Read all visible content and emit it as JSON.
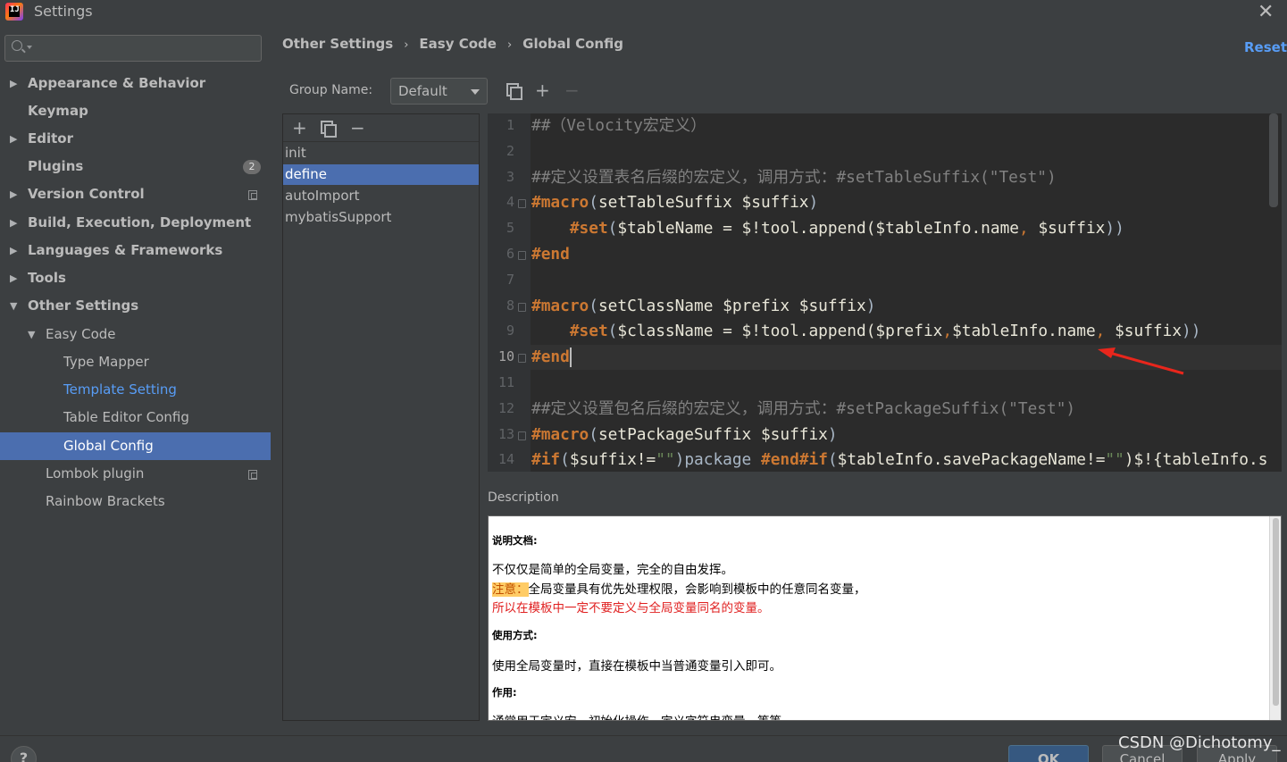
{
  "window": {
    "title": "Settings",
    "close_glyph": "✕"
  },
  "search": {
    "value": "",
    "placeholder": ""
  },
  "sidebar": {
    "items": [
      {
        "label": "Appearance & Behavior",
        "arrow": "▶"
      },
      {
        "label": "Keymap"
      },
      {
        "label": "Editor",
        "arrow": "▶"
      },
      {
        "label": "Plugins",
        "badge": "2"
      },
      {
        "label": "Version Control",
        "arrow": "▶"
      },
      {
        "label": "Build, Execution, Deployment",
        "arrow": "▶"
      },
      {
        "label": "Languages & Frameworks",
        "arrow": "▶"
      },
      {
        "label": "Tools",
        "arrow": "▶"
      },
      {
        "label": "Other Settings",
        "arrow": "▼"
      },
      {
        "label": "Easy Code",
        "arrow": "▼"
      },
      {
        "label": "Type Mapper"
      },
      {
        "label": "Template Setting"
      },
      {
        "label": "Table Editor Config"
      },
      {
        "label": "Global Config"
      },
      {
        "label": "Lombok plugin"
      },
      {
        "label": "Rainbow Brackets"
      }
    ]
  },
  "breadcrumb": {
    "items": [
      "Other Settings",
      "Easy Code",
      "Global Config"
    ],
    "separator": "›"
  },
  "reset_label": "Reset",
  "group": {
    "label": "Group Name:",
    "selected": "Default"
  },
  "toolbar": {
    "add_glyph": "+",
    "remove_glyph": "−"
  },
  "templates": {
    "items": [
      "init",
      "define",
      "autoImport",
      "mybatisSupport"
    ],
    "selected": "define"
  },
  "editor": {
    "line_numbers": [
      "1",
      "2",
      "3",
      "4",
      "5",
      "6",
      "7",
      "8",
      "9",
      "10",
      "11",
      "12",
      "13",
      "14"
    ],
    "lines": [
      [
        {
          "t": "##（Velocity宏定义）",
          "c": "cmt"
        }
      ],
      [],
      [
        {
          "t": "##定义设置表名后缀的宏定义，调用方式：#setTableSuffix(\"Test\")",
          "c": "cmt"
        }
      ],
      [
        {
          "t": "#macro",
          "c": "dir"
        },
        {
          "t": "(",
          "c": "plain"
        },
        {
          "t": "setTableSuffix ",
          "c": "var"
        },
        {
          "t": "$suffix",
          "c": "var"
        },
        {
          "t": ")",
          "c": "plain"
        }
      ],
      [
        {
          "t": "    ",
          "c": "plain"
        },
        {
          "t": "#set",
          "c": "dir"
        },
        {
          "t": "(",
          "c": "plain"
        },
        {
          "t": "$tableName = $!tool.append(",
          "c": "var"
        },
        {
          "t": "$tableInfo.name",
          "c": "var"
        },
        {
          "t": ", ",
          "c": "op"
        },
        {
          "t": "$suffix",
          "c": "var"
        },
        {
          "t": "))",
          "c": "plain"
        }
      ],
      [
        {
          "t": "#end",
          "c": "dir"
        }
      ],
      [],
      [
        {
          "t": "#macro",
          "c": "dir"
        },
        {
          "t": "(",
          "c": "plain"
        },
        {
          "t": "setClassName ",
          "c": "var"
        },
        {
          "t": "$prefix $suffix",
          "c": "var"
        },
        {
          "t": ")",
          "c": "plain"
        }
      ],
      [
        {
          "t": "    ",
          "c": "plain"
        },
        {
          "t": "#set",
          "c": "dir"
        },
        {
          "t": "(",
          "c": "plain"
        },
        {
          "t": "$className = $!tool.append(",
          "c": "var"
        },
        {
          "t": "$prefix",
          "c": "var"
        },
        {
          "t": ",",
          "c": "op"
        },
        {
          "t": "$tableInfo.name",
          "c": "var"
        },
        {
          "t": ", ",
          "c": "op"
        },
        {
          "t": "$suffix",
          "c": "var"
        },
        {
          "t": "))",
          "c": "plain"
        }
      ],
      [
        {
          "t": "#end",
          "c": "dir"
        }
      ],
      [],
      [
        {
          "t": "##定义设置包名后缀的宏定义，调用方式：#setPackageSuffix(\"Test\")",
          "c": "cmt"
        }
      ],
      [
        {
          "t": "#macro",
          "c": "dir"
        },
        {
          "t": "(",
          "c": "plain"
        },
        {
          "t": "setPackageSuffix ",
          "c": "var"
        },
        {
          "t": "$suffix",
          "c": "var"
        },
        {
          "t": ")",
          "c": "plain"
        }
      ],
      [
        {
          "t": "#if",
          "c": "dir"
        },
        {
          "t": "(",
          "c": "plain"
        },
        {
          "t": "$suffix!=",
          "c": "var"
        },
        {
          "t": "\"\"",
          "c": "str"
        },
        {
          "t": ")package ",
          "c": "plain"
        },
        {
          "t": "#end",
          "c": "dir"
        },
        {
          "t": "#if",
          "c": "dir"
        },
        {
          "t": "(",
          "c": "plain"
        },
        {
          "t": "$tableInfo.savePackageName!=",
          "c": "var"
        },
        {
          "t": "\"\"",
          "c": "str"
        },
        {
          "t": ")$!{tableInfo.s",
          "c": "var"
        }
      ]
    ]
  },
  "description": {
    "label": "Description",
    "doc_header": "说明文档:",
    "line1": "不仅仅是简单的全局变量，完全的自由发挥。",
    "note_label": "注意：",
    "note_text": "全局变量具有优先处理权限，会影响到模板中的任意同名变量，",
    "warning": "所以在模板中一定不要定义与全局变量同名的变量。",
    "usage_header": "使用方式:",
    "usage_text": "使用全局变量时，直接在模板中当普通变量引入即可。",
    "purpose_header": "作用:",
    "purpose_text": "通常用于定义宏、初始化操作、定义字符串变量，等等"
  },
  "buttons": {
    "help": "?",
    "ok": "OK",
    "cancel": "Cancel",
    "apply": "Apply"
  },
  "watermark": "CSDN @Dichotomy_"
}
